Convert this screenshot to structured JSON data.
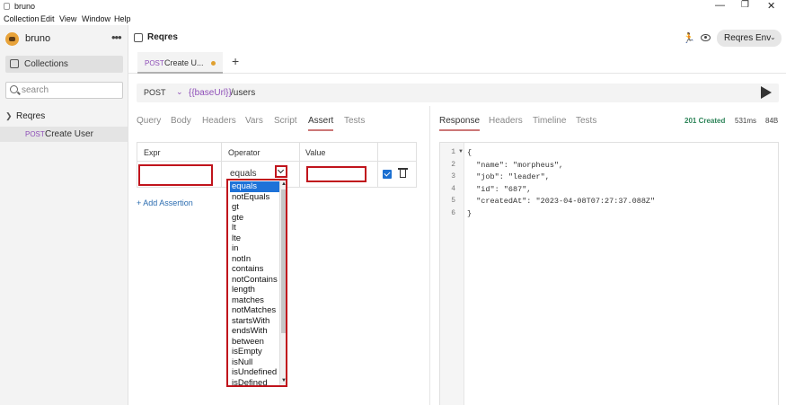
{
  "window": {
    "title": "bruno",
    "controls": [
      "minimize",
      "maximize",
      "close"
    ]
  },
  "menubar": [
    "Collection",
    "Edit",
    "View",
    "Window",
    "Help"
  ],
  "sidebar": {
    "brand": "bruno",
    "more": "•••",
    "collections_label": "Collections",
    "search_placeholder": "search",
    "collection": {
      "name": "Reqres",
      "chevron": "❯"
    },
    "request": {
      "method": "POST",
      "name": "Create User"
    }
  },
  "header": {
    "collection_title": "Reqres",
    "environment": "Reqres Env",
    "env_chevron": "⌄"
  },
  "tabs": [
    {
      "method": "POST",
      "label": "Create U...",
      "unsaved": true
    }
  ],
  "tab_add": "+",
  "request": {
    "method": "POST",
    "method_chevron": "⌄",
    "url_var": "{{baseUrl}}",
    "url_path": "/users"
  },
  "request_tabs": [
    "Query",
    "Body",
    "Headers",
    "Vars",
    "Script",
    "Assert",
    "Tests"
  ],
  "active_request_tab": "Assert",
  "response_tabs": [
    "Response",
    "Headers",
    "Timeline",
    "Tests"
  ],
  "active_response_tab": "Response",
  "response_status": {
    "status": "201 Created",
    "time": "531ms",
    "size": "84B",
    "status_color": "#2f855a"
  },
  "assert_table": {
    "headers": [
      "Expr",
      "Operator",
      "Value"
    ],
    "row": {
      "expr": "",
      "operator": "equals",
      "value": "",
      "enabled": true
    },
    "add_label": "+ Add Assertion"
  },
  "operator_options": [
    "equals",
    "notEquals",
    "gt",
    "gte",
    "lt",
    "lte",
    "in",
    "notIn",
    "contains",
    "notContains",
    "length",
    "matches",
    "notMatches",
    "startsWith",
    "endsWith",
    "between",
    "isEmpty",
    "isNull",
    "isUndefined",
    "isDefined"
  ],
  "selected_operator": "equals",
  "response_body": {
    "line_numbers": [
      "1",
      "2",
      "3",
      "4",
      "5",
      "6"
    ],
    "lines": [
      "{",
      "  \"name\": \"morpheus\",",
      "  \"job\": \"leader\",",
      "  \"id\": \"687\",",
      "  \"createdAt\": \"2023-04-08T07:27:37.088Z\"",
      "}"
    ]
  },
  "colors": {
    "highlight_border": "#c0141c",
    "method_purple": "#8e4fb8",
    "link_blue": "#2b6cb0",
    "selection_blue": "#1e72d8"
  }
}
